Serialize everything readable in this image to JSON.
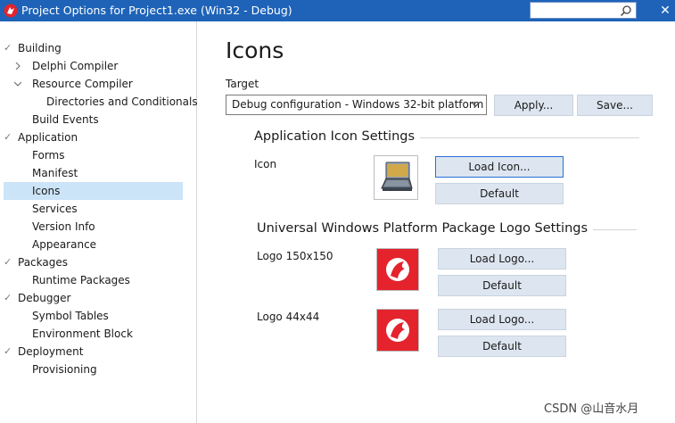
{
  "window": {
    "title": "Project Options for Project1.exe  (Win32 - Debug)",
    "close_glyph": "✕",
    "search_placeholder": "",
    "accent_color": "#1e63b8"
  },
  "sidebar": {
    "items": [
      {
        "label": "Building",
        "level": 0,
        "mark": "✓"
      },
      {
        "label": "Delphi Compiler",
        "level": 1,
        "expander": "collapsed"
      },
      {
        "label": "Resource Compiler",
        "level": 1,
        "expander": "expanded"
      },
      {
        "label": "Directories and Conditionals",
        "level": 2
      },
      {
        "label": "Build Events",
        "level": 1
      },
      {
        "label": "Application",
        "level": 0,
        "mark": "✓"
      },
      {
        "label": "Forms",
        "level": 1
      },
      {
        "label": "Manifest",
        "level": 1
      },
      {
        "label": "Icons",
        "level": 1,
        "selected": true
      },
      {
        "label": "Services",
        "level": 1
      },
      {
        "label": "Version Info",
        "level": 1
      },
      {
        "label": "Appearance",
        "level": 1
      },
      {
        "label": "Packages",
        "level": 0,
        "mark": "✓"
      },
      {
        "label": "Runtime Packages",
        "level": 1
      },
      {
        "label": "Debugger",
        "level": 0,
        "mark": "✓"
      },
      {
        "label": "Symbol Tables",
        "level": 1
      },
      {
        "label": "Environment Block",
        "level": 1
      },
      {
        "label": "Deployment",
        "level": 0,
        "mark": "✓"
      },
      {
        "label": "Provisioning",
        "level": 1
      }
    ]
  },
  "main": {
    "title": "Icons",
    "target_label": "Target",
    "target_value": "Debug configuration - Windows 32-bit platform",
    "apply_label": "Apply...",
    "save_label": "Save...",
    "app_icon_section": {
      "title": "Application Icon Settings",
      "icon_label": "Icon",
      "load_icon_label": "Load Icon...",
      "default_label": "Default"
    },
    "uwp_section": {
      "title": "Universal Windows Platform Package Logo Settings",
      "logo150_label": "Logo 150x150",
      "logo44_label": "Logo 44x44",
      "load_logo_label": "Load Logo...",
      "default_label": "Default",
      "logo_color": "#e4232d"
    }
  },
  "watermark": "CSDN @山音水月"
}
